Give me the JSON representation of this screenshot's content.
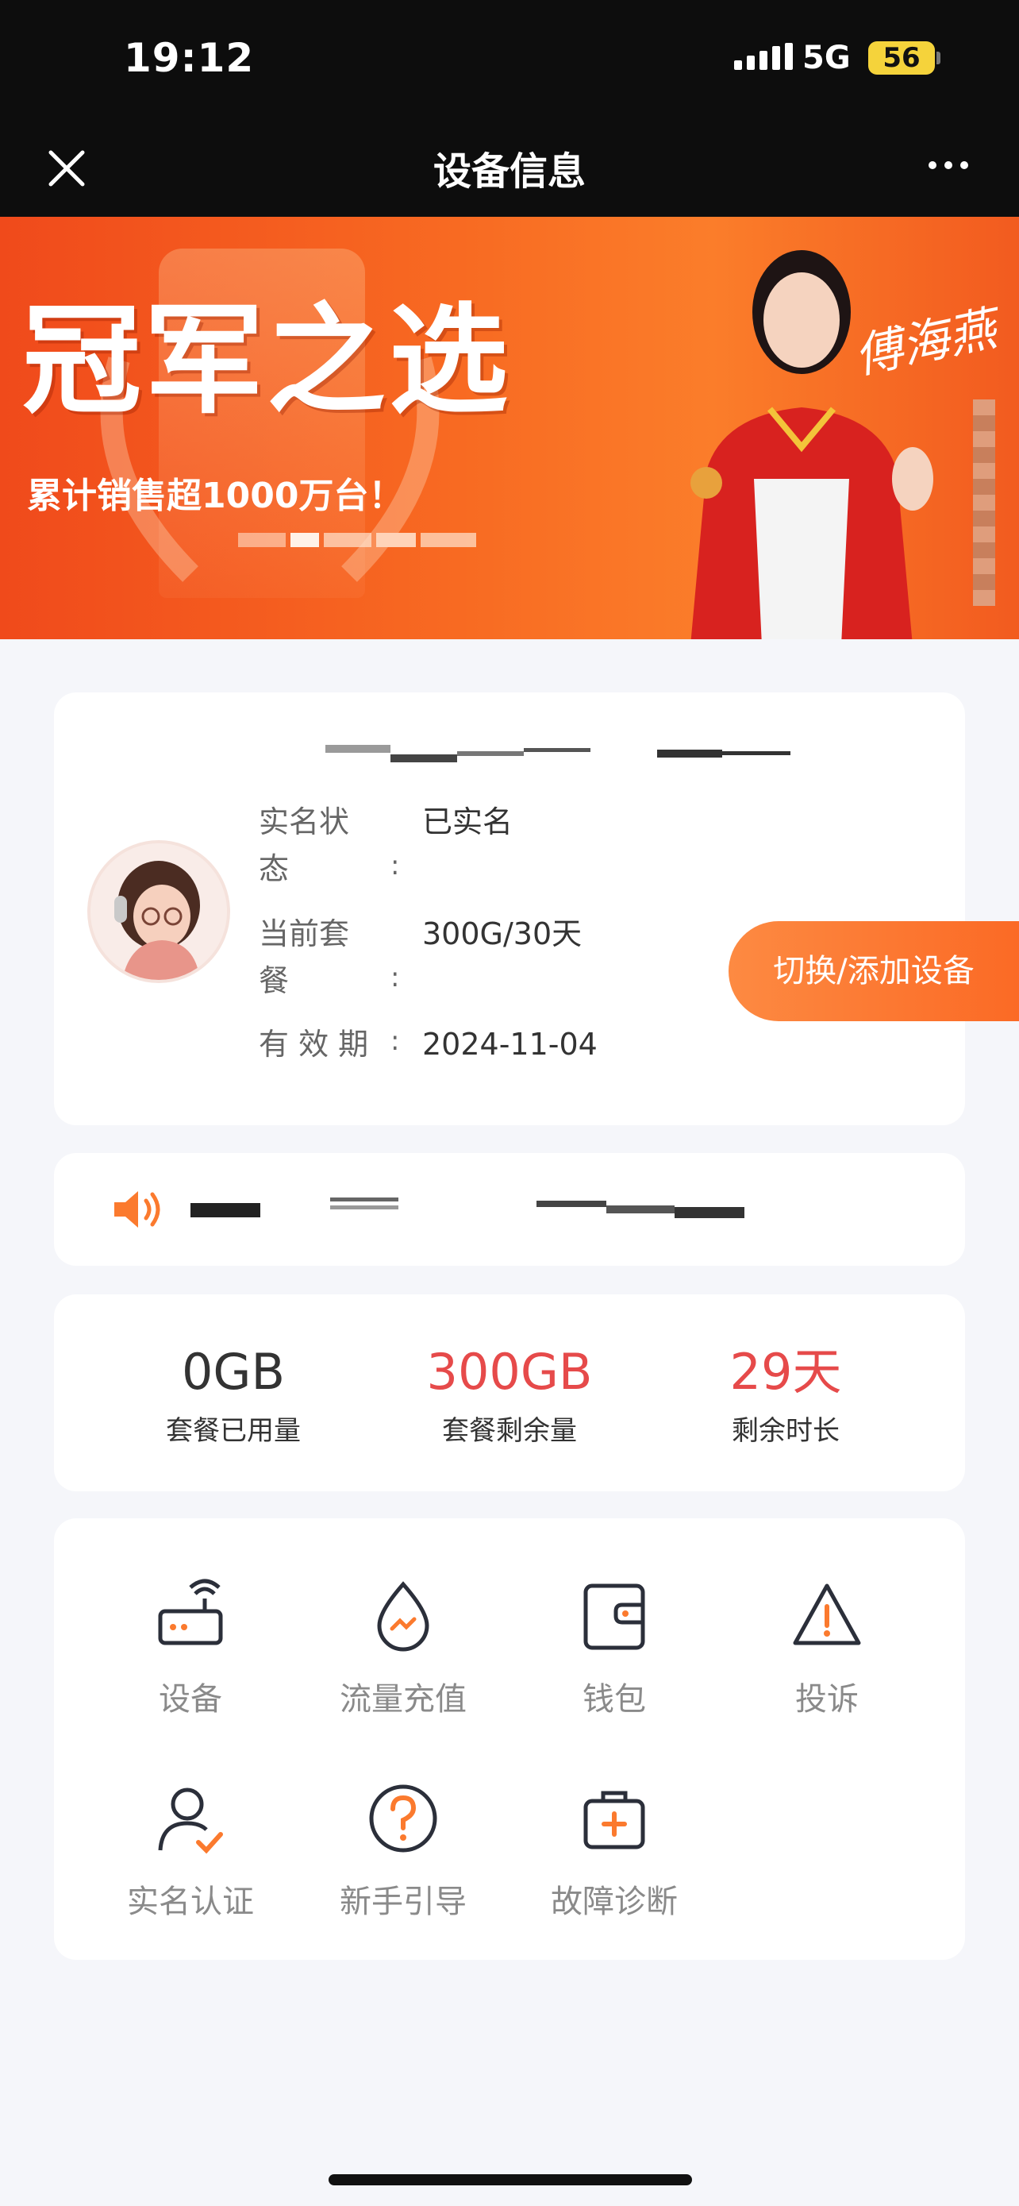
{
  "status_bar": {
    "time": "19:12",
    "network": "5G",
    "battery": "56"
  },
  "nav": {
    "title": "设备信息"
  },
  "banner": {
    "headline": "冠军之选",
    "subline": "累计销售超1000万台！"
  },
  "device_info": {
    "rows": [
      {
        "label_line1": "实名状",
        "label_line2": "态",
        "value": "已实名"
      },
      {
        "label_line1": "当前套",
        "label_line2": "餐",
        "value": "300G/30天"
      },
      {
        "label_line1": "有 效 期",
        "label_line2": "",
        "value": "2024-11-04"
      }
    ],
    "switch_button": "切换/添加设备"
  },
  "stats": [
    {
      "value": "0GB",
      "label": "套餐已用量",
      "color": "#333333"
    },
    {
      "value": "300GB",
      "label": "套餐剩余量",
      "color": "#e64a4a"
    },
    {
      "value": "29天",
      "label": "剩余时长",
      "color": "#e64a4a"
    }
  ],
  "menu": [
    {
      "label": "设备",
      "icon": "router-icon"
    },
    {
      "label": "流量充值",
      "icon": "data-drop-icon"
    },
    {
      "label": "钱包",
      "icon": "wallet-icon"
    },
    {
      "label": "投诉",
      "icon": "warning-icon"
    },
    {
      "label": "实名认证",
      "icon": "user-check-icon"
    },
    {
      "label": "新手引导",
      "icon": "help-icon"
    },
    {
      "label": "故障诊断",
      "icon": "medical-kit-icon"
    }
  ],
  "colors": {
    "accent": "#fb7a2e",
    "warn": "#e64a4a",
    "dark_icon": "#2b2f3a"
  }
}
